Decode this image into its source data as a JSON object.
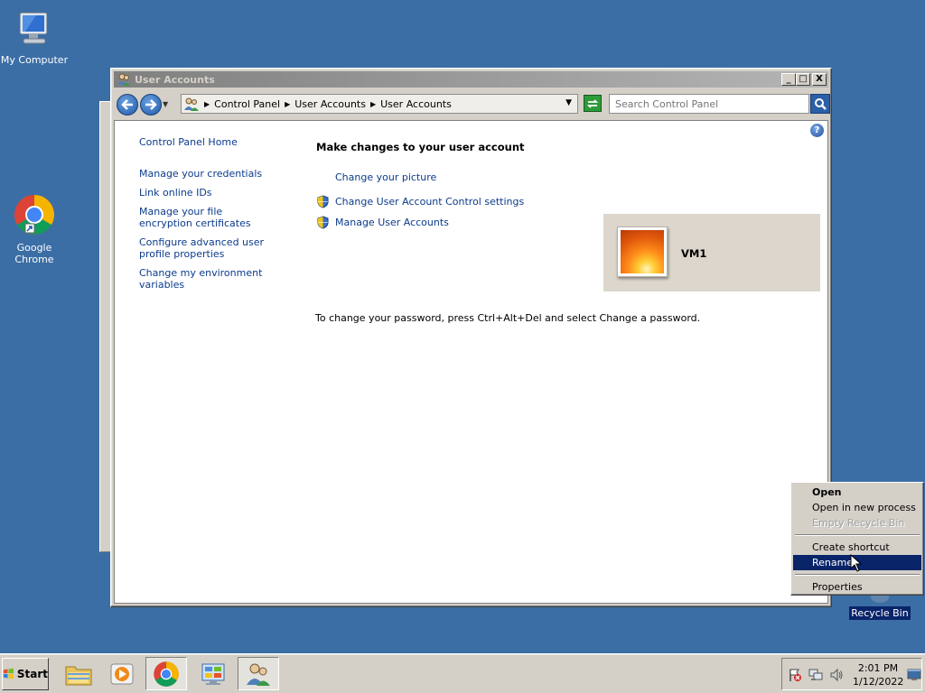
{
  "desktop": {
    "icons": [
      {
        "label": "My Computer",
        "icon": "computer-icon"
      },
      {
        "label": "Google Chrome",
        "icon": "chrome-icon"
      },
      {
        "label": "Recycle Bin",
        "icon": "recycle-bin-icon"
      }
    ]
  },
  "window": {
    "title": "User Accounts",
    "buttons": {
      "minimize": "_",
      "maximize": "□",
      "close": "X"
    },
    "breadcrumb": [
      "Control Panel",
      "User Accounts",
      "User Accounts"
    ],
    "search_placeholder": "Search Control Panel",
    "left_links": [
      "Control Panel Home",
      "Manage your credentials",
      "Link online IDs",
      "Manage your file encryption certificates",
      "Configure advanced user profile properties",
      "Change my environment variables"
    ],
    "heading": "Make changes to your user account",
    "tasks": [
      "Change your picture",
      "Change User Account Control settings",
      "Manage User Accounts"
    ],
    "username": "VM1",
    "info": "To change your password, press Ctrl+Alt+Del and select Change a password."
  },
  "context_menu": {
    "items": [
      {
        "label": "Open",
        "bold": true,
        "disabled": false,
        "highlighted": false
      },
      {
        "label": "Open in new process",
        "bold": false,
        "disabled": false,
        "highlighted": false
      },
      {
        "label": "Empty Recycle Bin",
        "bold": false,
        "disabled": true,
        "highlighted": false
      },
      {
        "label": "Create shortcut",
        "bold": false,
        "disabled": false,
        "highlighted": false
      },
      {
        "label": "Rename",
        "bold": false,
        "disabled": false,
        "highlighted": true
      },
      {
        "label": "Properties",
        "bold": false,
        "disabled": false,
        "highlighted": false
      }
    ]
  },
  "taskbar": {
    "start_label": "Start",
    "quick_launch": [
      "explorer-icon",
      "media-player-icon",
      "chrome-icon",
      "control-panel-icon",
      "user-accounts-icon"
    ],
    "clock": {
      "time": "2:01 PM",
      "date": "1/12/2022"
    }
  },
  "colors": {
    "desktop": "#3b6ea5",
    "link": "#0b3b8c",
    "highlight": "#0a246a"
  }
}
